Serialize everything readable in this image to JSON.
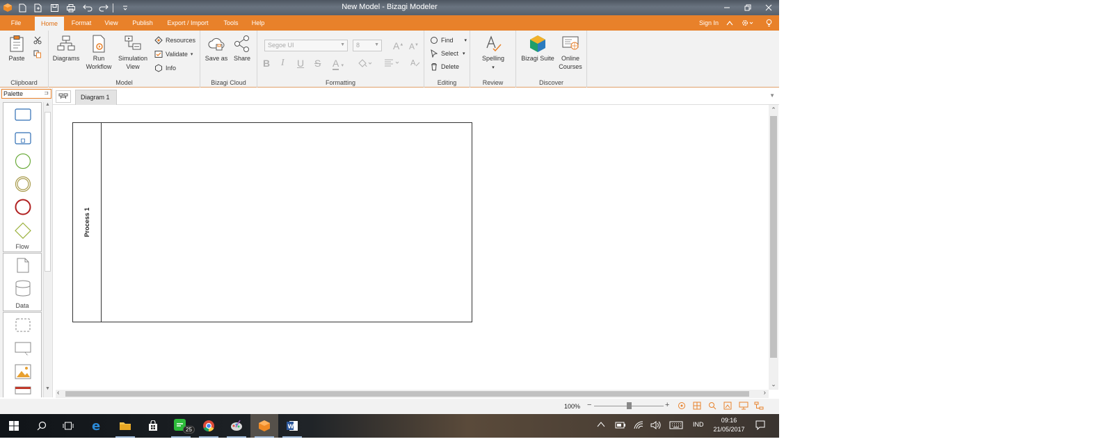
{
  "window": {
    "title": "New Model - Bizagi Modeler"
  },
  "tabs": [
    {
      "label": "File"
    },
    {
      "label": "Home"
    },
    {
      "label": "Format"
    },
    {
      "label": "View"
    },
    {
      "label": "Publish"
    },
    {
      "label": "Export / Import"
    },
    {
      "label": "Tools"
    },
    {
      "label": "Help"
    }
  ],
  "account": {
    "sign_in": "Sign In"
  },
  "ribbon": {
    "clipboard": {
      "label": "Clipboard",
      "paste": "Paste"
    },
    "model": {
      "label": "Model",
      "diagrams": "Diagrams",
      "run_workflow_1": "Run",
      "run_workflow_2": "Workflow",
      "simulation_1": "Simulation",
      "simulation_2": "View",
      "resources": "Resources",
      "validate": "Validate",
      "info": "Info"
    },
    "cloud": {
      "label": "Bizagi Cloud",
      "save_as": "Save as",
      "share": "Share"
    },
    "formatting": {
      "label": "Formatting",
      "font_name": "Segoe UI",
      "font_size": "8"
    },
    "editing": {
      "label": "Editing",
      "find": "Find",
      "select": "Select",
      "delete": "Delete"
    },
    "review": {
      "label": "Review",
      "spelling": "Spelling"
    },
    "discover": {
      "label": "Discover",
      "bizagi_suite": "Bizagi Suite",
      "online_courses_1": "Online",
      "online_courses_2": "Courses"
    }
  },
  "palette": {
    "title": "Palette",
    "flow_label": "Flow",
    "data_label": "Data"
  },
  "document": {
    "tab": "Diagram 1"
  },
  "diagram": {
    "pool_label": "Process 1"
  },
  "status": {
    "zoom": "100%",
    "zoom_level": 0.5
  },
  "taskbar": {
    "language": "IND",
    "time": "09:16",
    "date": "21/05/2017",
    "line_badge": "25"
  },
  "colors": {
    "accent": "#e8812a",
    "ribbon_bg": "#f2f2f2"
  }
}
